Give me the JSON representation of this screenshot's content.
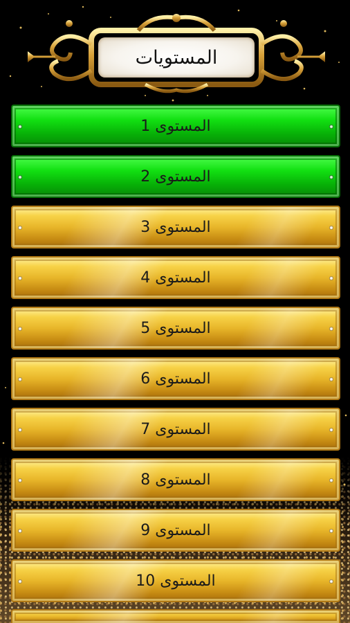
{
  "header": {
    "title": "المستويات"
  },
  "colors": {
    "unlocked": "#10d010",
    "locked": "#e8b62a",
    "background": "#000000"
  },
  "levels": [
    {
      "label": "المستوى 1",
      "state": "unlocked"
    },
    {
      "label": "المستوى 2",
      "state": "unlocked"
    },
    {
      "label": "المستوى 3",
      "state": "locked"
    },
    {
      "label": "المستوى 4",
      "state": "locked"
    },
    {
      "label": "المستوى 5",
      "state": "locked"
    },
    {
      "label": "المستوى 6",
      "state": "locked"
    },
    {
      "label": "المستوى 7",
      "state": "locked"
    },
    {
      "label": "المستوى 8",
      "state": "locked"
    },
    {
      "label": "المستوى 9",
      "state": "locked"
    },
    {
      "label": "المستوى 10",
      "state": "locked"
    },
    {
      "label": "",
      "state": "locked"
    }
  ]
}
